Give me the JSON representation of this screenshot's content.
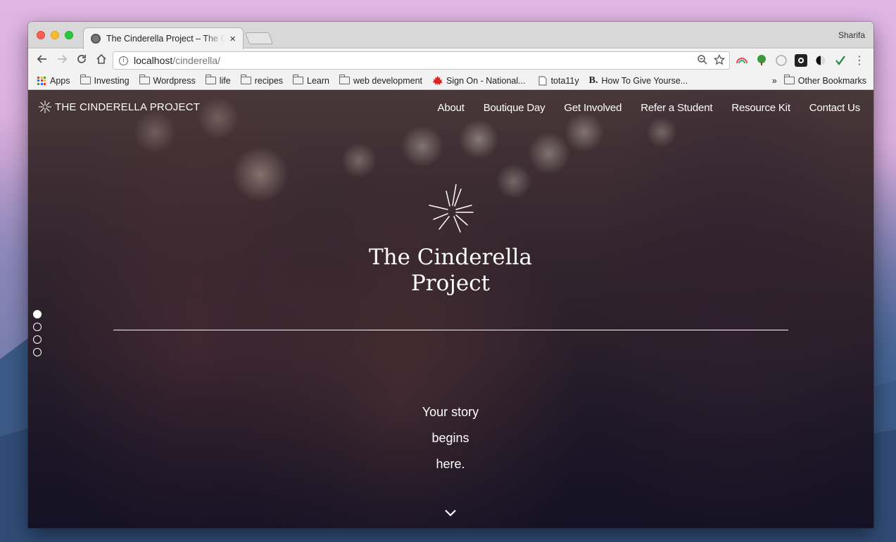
{
  "browser": {
    "tab_title": "The Cinderella Project – The Cinderella Project",
    "tab_close": "×",
    "profile_name": "Sharifa",
    "url_host": "localhost",
    "url_path": "/cinderella/",
    "info_glyph": "i",
    "bookmarks": [
      {
        "label": "Apps",
        "icon": "apps-grid-icon"
      },
      {
        "label": "Investing",
        "icon": "folder-icon"
      },
      {
        "label": "Wordpress",
        "icon": "folder-icon"
      },
      {
        "label": "life",
        "icon": "folder-icon"
      },
      {
        "label": "recipes",
        "icon": "folder-icon"
      },
      {
        "label": "Learn",
        "icon": "folder-icon"
      },
      {
        "label": "web development",
        "icon": "folder-icon"
      },
      {
        "label": "Sign On - National...",
        "icon": "maple-leaf-icon"
      },
      {
        "label": "tota11y",
        "icon": "page-icon"
      },
      {
        "label": "How To Give Yourse...",
        "icon": "b-logo-icon"
      }
    ],
    "bookmarks_overflow": "»",
    "other_bookmarks": "Other Bookmarks"
  },
  "site": {
    "logo_text": "THE CINDERELLA PROJECT",
    "nav": [
      "About",
      "Boutique Day",
      "Get Involved",
      "Refer a Student",
      "Resource Kit",
      "Contact Us"
    ],
    "hero_title_line1": "The Cinderella",
    "hero_title_line2": "Project",
    "tagline_line1": "Your story",
    "tagline_line2": "begins",
    "tagline_line3": "here.",
    "slide_count": 4,
    "active_slide": 1
  },
  "colors": {
    "accent": "#ffffff",
    "overlay": "#1a1630"
  }
}
